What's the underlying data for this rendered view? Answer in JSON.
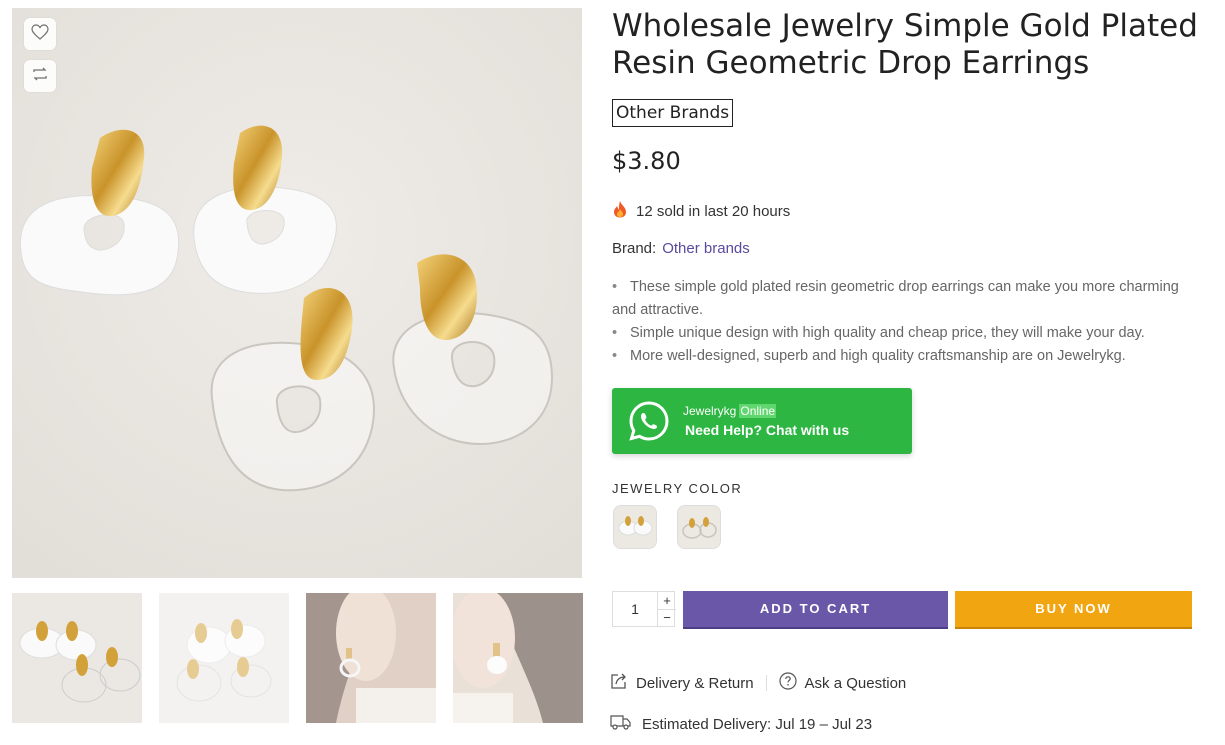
{
  "product": {
    "title": "Wholesale Jewelry Simple Gold Plated Resin Geometric Drop Earrings",
    "brand_badge": "Other Brands",
    "price": "$3.80",
    "sold_text": "12 sold in last 20 hours",
    "brand_label": "Brand:",
    "brand_link": "Other brands",
    "description": [
      "These simple gold plated resin geometric drop earrings can make you more charming and attractive.",
      "Simple unique design with high quality and cheap price, they will make your day.",
      "More well-designed, superb and high quality craftsmanship are on Jewelrykg."
    ]
  },
  "whatsapp": {
    "name": "Jewelrykg",
    "status": "Online",
    "cta": "Need Help? Chat with us"
  },
  "variant": {
    "label": "JEWELRY COLOR"
  },
  "purchase": {
    "quantity": "1",
    "plus": "+",
    "minus": "−",
    "add_to_cart": "ADD TO CART",
    "buy_now": "BUY NOW"
  },
  "links": {
    "delivery_return": "Delivery & Return",
    "ask_question": "Ask a Question",
    "estimated_delivery": "Estimated Delivery: Jul 19 – Jul 23"
  },
  "icons": [
    "heart-icon",
    "compare-icon",
    "fire-icon",
    "whatsapp-icon",
    "share-box-icon",
    "question-icon",
    "truck-icon"
  ],
  "colors": {
    "accent": "#6a57a8",
    "buy": "#f1a511",
    "whatsapp": "#2db742",
    "link": "#5b4a9e"
  }
}
